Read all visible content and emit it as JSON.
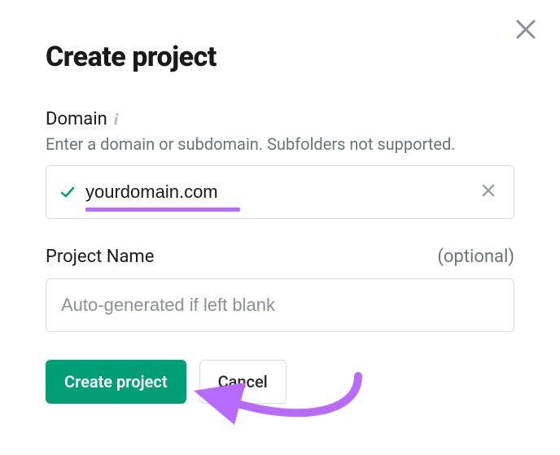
{
  "modal": {
    "title": "Create project",
    "close_icon": "close"
  },
  "domain_section": {
    "label": "Domain",
    "info_icon": "info",
    "hint": "Enter a domain or subdomain. Subfolders not supported.",
    "value": "yourdomain.com",
    "valid_icon": "checkmark",
    "clear_icon": "clear"
  },
  "project_section": {
    "label": "Project Name",
    "optional_text": "(optional)",
    "placeholder": "Auto-generated if left blank",
    "value": ""
  },
  "buttons": {
    "create_label": "Create project",
    "cancel_label": "Cancel"
  },
  "annotation": {
    "accent_color": "#b76bff"
  }
}
